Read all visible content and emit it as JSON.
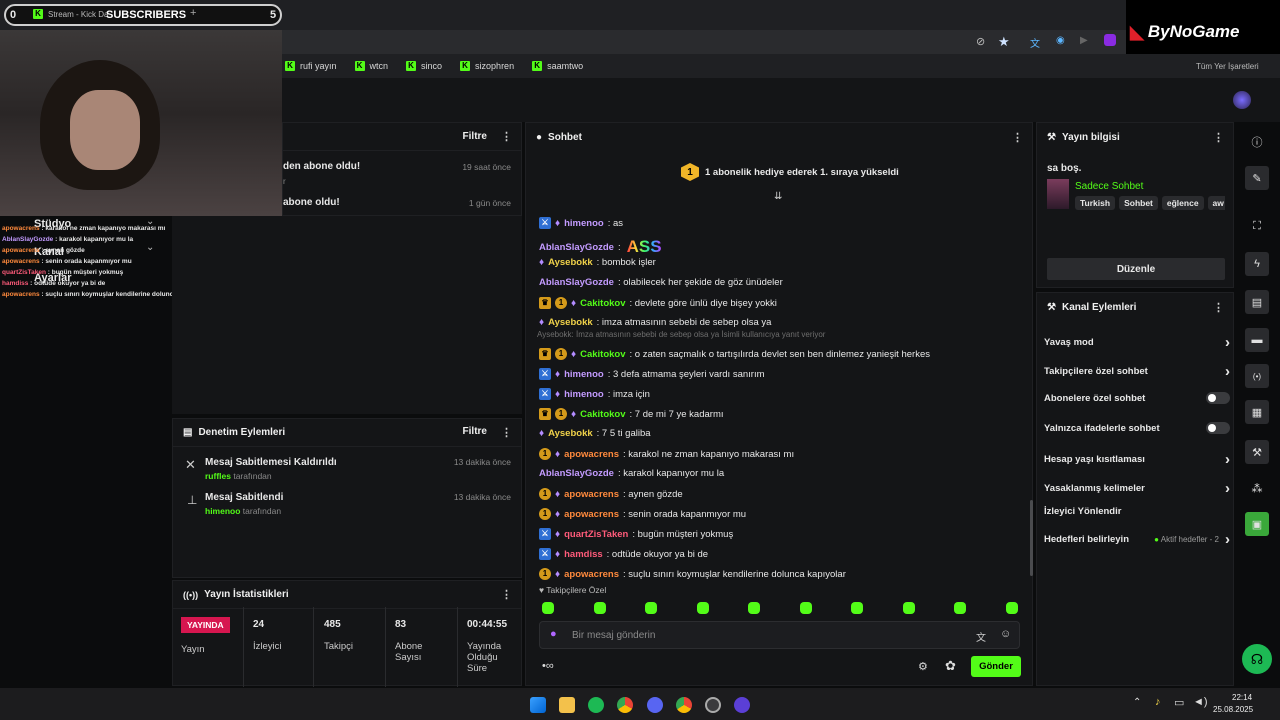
{
  "browser": {
    "tab_title": "Stream - Kick Da",
    "overlay": {
      "left_count": "0",
      "label": "SUBSCRIBERS",
      "right_count": "5",
      "plus": "+"
    },
    "bookmarks": [
      "rufi yayın",
      "wtcn",
      "sinco",
      "sizophren",
      "saamtwo"
    ],
    "bookmarks_right": "Tüm Yer İşaretleri",
    "brand": "ByNoGame"
  },
  "activity": {
    "filter_label": "Filtre",
    "items": [
      {
        "text": "den abone oldu!",
        "sub": "r",
        "time": "19 saat önce"
      },
      {
        "text": "abone oldu!",
        "sub": "",
        "time": "1 gün önce"
      }
    ]
  },
  "overlay_chat": [
    {
      "user": "apowacrens",
      "text": " : karakol ne zman kapanıyo makarası mı"
    },
    {
      "user": "AblanSlayGozde",
      "text": " : karakol kapanıyor mu la"
    },
    {
      "user": "apowacrens",
      "text": " : aynen gözde"
    },
    {
      "user": "apowacrens",
      "text": " : senin orada kapanmıyor mu"
    },
    {
      "user": "quartZisTaken",
      "text": " : bugün müşteri yokmuş"
    },
    {
      "user": "hamdiss",
      "text": " : odtüde okuyor ya bi de"
    },
    {
      "user": "apowacrens",
      "text": " : suçlu sınırı koymuşlar kendilerine dolunca kapıyolar"
    }
  ],
  "left_nav": {
    "studio": "Stüdyo",
    "kanal": "Kanal",
    "ayarlar": "Ayarlar"
  },
  "moderation": {
    "title": "Denetim Eylemleri",
    "filter_label": "Filtre",
    "items": [
      {
        "title": "Mesaj Sabitlemesi Kaldırıldı",
        "user": "ruffles",
        "by": " tarafından",
        "time": "13 dakika önce"
      },
      {
        "title": "Mesaj Sabitlendi",
        "user": "himenoo",
        "by": " tarafından",
        "time": "13 dakika önce"
      }
    ]
  },
  "stats": {
    "title": "Yayın İstatistikleri",
    "live_badge": "YAYINDA",
    "live_label": "Yayın",
    "cells": [
      {
        "value": "24",
        "label": "İzleyici"
      },
      {
        "value": "485",
        "label": "Takipçi"
      },
      {
        "value": "83",
        "label": "Abone Sayısı"
      },
      {
        "value": "00:44:55",
        "label": "Yayında Olduğu Süre"
      }
    ]
  },
  "chat": {
    "title": "Sohbet",
    "pinned_rank": "1",
    "pinned_text": "1 abonelik hediye ederek 1. sıraya yükseldi",
    "reply_context": "Aysebokk: İmza atmasının sebebi de sebep olsa ya İsimli kullanıcıya yanıt veriyor",
    "messages": [
      {
        "badges": [
          "x",
          "g"
        ],
        "user": "himenoo",
        "color": "#c39bff",
        "text": ": as"
      },
      {
        "badges": [],
        "user": "AblanSlayGozde",
        "color": "#c39bff",
        "text": ":",
        "emote": "ASS"
      },
      {
        "badges": [
          "g"
        ],
        "user": "Aysebokk",
        "color": "#f0d24a",
        "text": ": bombok işler"
      },
      {
        "badges": [],
        "user": "AblanSlayGozde",
        "color": "#c39bff",
        "text": ": olabilecek her şekide de göz ünüdeler"
      },
      {
        "badges": [
          "c",
          "1",
          "g"
        ],
        "user": "Cakitokov",
        "color": "#53fc18",
        "text": ": devlete göre ünlü diye bişey yokki"
      },
      {
        "badges": [
          "g"
        ],
        "user": "Aysebokk",
        "color": "#f0d24a",
        "text": ": imza atmasının sebebi de sebep olsa ya"
      },
      {
        "badges": [
          "c",
          "1",
          "g"
        ],
        "user": "Cakitokov",
        "color": "#53fc18",
        "text": ": o zaten saçmalık o tartışılırda devlet sen ben dinlemez yanieşit herkes"
      },
      {
        "badges": [
          "x",
          "g"
        ],
        "user": "himenoo",
        "color": "#c39bff",
        "text": ": 3 defa atmama şeyleri vardı sanırım"
      },
      {
        "badges": [
          "x",
          "g"
        ],
        "user": "himenoo",
        "color": "#c39bff",
        "text": ": imza için"
      },
      {
        "badges": [
          "c",
          "1",
          "g"
        ],
        "user": "Cakitokov",
        "color": "#53fc18",
        "text": ": 7 de mi 7 ye kadarmı"
      },
      {
        "badges": [
          "g"
        ],
        "user": "Aysebokk",
        "color": "#f0d24a",
        "text": ": 7 5 ti galiba"
      },
      {
        "badges": [
          "1",
          "g"
        ],
        "user": "apowacrens",
        "color": "#ff8a3d",
        "text": ": karakol ne zman kapanıyo makarası mı"
      },
      {
        "badges": [],
        "user": "AblanSlayGozde",
        "color": "#c39bff",
        "text": ": karakol kapanıyor mu la"
      },
      {
        "badges": [
          "1",
          "g"
        ],
        "user": "apowacrens",
        "color": "#ff8a3d",
        "text": ": aynen gözde"
      },
      {
        "badges": [
          "1",
          "g"
        ],
        "user": "apowacrens",
        "color": "#ff8a3d",
        "text": ": senin orada kapanmıyor mu"
      },
      {
        "badges": [
          "x",
          "g"
        ],
        "user": "quartZisTaken",
        "color": "#ff5b7a",
        "text": ": bugün müşteri yokmuş"
      },
      {
        "badges": [
          "x",
          "g"
        ],
        "user": "hamdiss",
        "color": "#ff5b7a",
        "text": ": odtüde okuyor ya bi de"
      },
      {
        "badges": [
          "1",
          "g"
        ],
        "user": "apowacrens",
        "color": "#ff8a3d",
        "text": ": suçlu sınırı koymuşlar kendilerine dolunca kapıyolar"
      }
    ],
    "followers_only": "Takipçilere Özel",
    "input_placeholder": "Bir mesaj gönderin",
    "send_label": "Gönder"
  },
  "stream_info": {
    "title": "Yayın bilgisi",
    "stream_title": "sa boş.",
    "category": "Sadece Sohbet",
    "tags": [
      "Turkish",
      "Sohbet",
      "eğlence",
      "aw"
    ],
    "edit_label": "Düzenle"
  },
  "channel_actions": {
    "title": "Kanal Eylemleri",
    "items": [
      {
        "label": "Yavaş mod",
        "control": "chevron"
      },
      {
        "label": "Takipçilere özel sohbet",
        "control": "chevron"
      },
      {
        "label": "Abonelere özel sohbet",
        "control": "toggle"
      },
      {
        "label": "Yalnızca ifadelerle sohbet",
        "control": "toggle"
      },
      {
        "label": "Hesap yaşı kısıtlaması",
        "control": "chevron"
      },
      {
        "label": "Yasaklanmış kelimeler",
        "control": "chevron"
      },
      {
        "label": "İzleyici Yönlendir",
        "control": "none"
      },
      {
        "label": "Hedefleri belirleyin",
        "control": "chevron",
        "status": "Aktif hedefler - 2"
      }
    ]
  },
  "taskbar": {
    "time": "22:14",
    "date": "25.08.2025"
  },
  "colors": {
    "accent": "#53fc18",
    "live": "#d6164f",
    "panel": "#141517",
    "bg": "#0b0c0d"
  }
}
